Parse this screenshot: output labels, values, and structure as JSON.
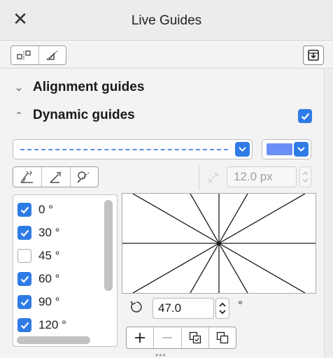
{
  "window": {
    "title": "Live Guides",
    "close_icon": "close-icon"
  },
  "toolbar": {
    "buttons": [
      "alignment-guides-icon",
      "dynamic-guides-icon"
    ],
    "right_button": "save-preset-icon"
  },
  "sections": {
    "alignment": {
      "label": "Alignment guides",
      "expanded": false
    },
    "dynamic": {
      "label": "Dynamic guides",
      "expanded": true,
      "checked": true
    }
  },
  "line_style": {
    "selected": "dashed-line"
  },
  "line_color": {
    "selected": "#6b8ff5"
  },
  "guide_tools": [
    "snap-guide-icon",
    "extension-guide-icon",
    "tangent-guide-icon"
  ],
  "spacing": {
    "value": "12.0 px",
    "enabled": false
  },
  "angles": [
    {
      "label": "0 °",
      "checked": true
    },
    {
      "label": "30 °",
      "checked": true
    },
    {
      "label": "45 °",
      "checked": false
    },
    {
      "label": "60 °",
      "checked": true
    },
    {
      "label": "90 °",
      "checked": true
    },
    {
      "label": "120 °",
      "checked": true
    }
  ],
  "rotation": {
    "value": "47.0",
    "unit": "°"
  },
  "actions": [
    "add-icon",
    "remove-icon",
    "copy-icon",
    "reset-icon"
  ],
  "colors": {
    "accent": "#2f7be6",
    "dash": "#5b8ee8"
  }
}
